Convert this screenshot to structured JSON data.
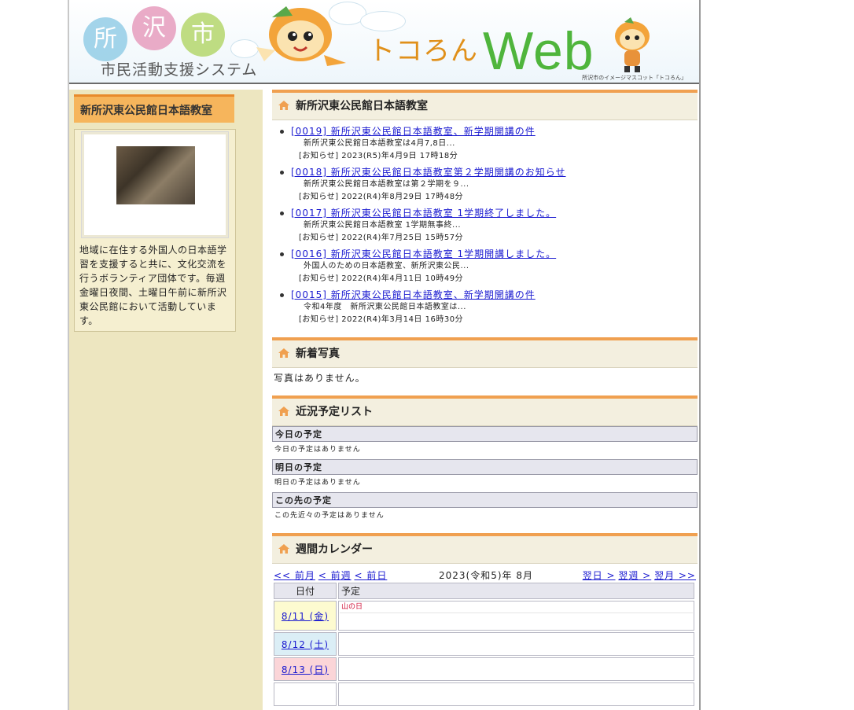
{
  "header": {
    "logo_chars": [
      "所",
      "沢",
      "市"
    ],
    "logo_subtitle": "市民活動支援システム",
    "web_prefix": "トコろん",
    "web_title": "Web",
    "mascot_caption": "所沢市のイメージマスコット「トコろん」"
  },
  "sidebar": {
    "club_title": "新所沢東公民館日本語教室",
    "description": "地域に在住する外国人の日本語学習を支援すると共に、文化交流を行うボランティア団体です。毎週金曜日夜間、土曜日午前に新所沢東公民館において活動しています。"
  },
  "news": {
    "heading": "新所沢東公民館日本語教室",
    "items": [
      {
        "title": "[0019] 新所沢東公民館日本語教室、新学期開講の件",
        "snippet": "新所沢東公民館日本語教室は4月7,8日...",
        "meta": "[お知らせ] 2023(R5)年4月9日 17時18分"
      },
      {
        "title": "[0018] 新所沢東公民館日本語教室第２学期開講のお知らせ",
        "snippet": "新所沢東公民館日本語教室は第２学期を９...",
        "meta": "[お知らせ] 2022(R4)年8月29日 17時48分"
      },
      {
        "title": "[0017] 新所沢東公民館日本語教室 1学期終了しました。",
        "snippet": "新所沢東公民館日本語教室 1学期無事終...",
        "meta": "[お知らせ] 2022(R4)年7月25日 15時57分"
      },
      {
        "title": "[0016] 新所沢東公民館日本語教室 1学期開講しました。",
        "snippet": "外国人のための日本語教室、新所沢東公民...",
        "meta": "[お知らせ] 2022(R4)年4月11日 10時49分"
      },
      {
        "title": "[0015] 新所沢東公民館日本語教室、新学期開講の件",
        "snippet": "令和4年度　新所沢東公民館日本語教室は...",
        "meta": "[お知らせ] 2022(R4)年3月14日 16時30分"
      }
    ]
  },
  "photos": {
    "heading": "新着写真",
    "empty": "写真はありません。"
  },
  "schedule": {
    "heading": "近況予定リスト",
    "today_label": "今日の予定",
    "today_note": "今日の予定はありません",
    "tomorrow_label": "明日の予定",
    "tomorrow_note": "明日の予定はありません",
    "future_label": "この先の予定",
    "future_note": "この先近々の予定はありません"
  },
  "calendar": {
    "heading": "週間カレンダー",
    "prev_month": "<< 前月",
    "prev_week": "< 前週",
    "prev_day": "< 前日",
    "current": "2023(令和5)年 8月",
    "next_day": "翌日 >",
    "next_week": "翌週 >",
    "next_month": "翌月 >>",
    "col_date": "日付",
    "col_plan": "予定",
    "rows": [
      {
        "date": "8/11 (金)",
        "holiday": "山の日",
        "bg": "#fdfbd0"
      },
      {
        "date": "8/12 (土)",
        "holiday": "",
        "bg": "#dbeef6"
      },
      {
        "date": "8/13 (日)",
        "holiday": "",
        "bg": "#fbd5d8"
      },
      {
        "date": "",
        "holiday": "",
        "bg": "#ffffff"
      }
    ]
  },
  "colors": {
    "accent_orange": "#f0a050",
    "link_blue": "#1a1ad0",
    "sidebar_bg": "#ede6c0",
    "holiday_red": "#d0143c"
  }
}
